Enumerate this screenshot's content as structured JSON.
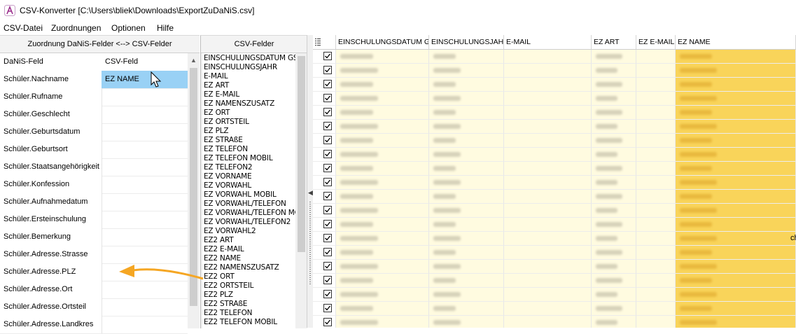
{
  "window": {
    "title": "CSV-Konverter [C:\\Users\\bliek\\Downloads\\ExportZuDaNiS.csv]",
    "app_icon": "app-logo-icon"
  },
  "menu": {
    "items": [
      "CSV-Datei",
      "Zuordnungen",
      "Optionen",
      "Hilfe"
    ]
  },
  "mapping": {
    "panel_title": "Zuordnung DaNiS-Felder <--> CSV-Felder",
    "col_dan": "DaNiS-Feld",
    "col_csv": "CSV-Feld",
    "rows": [
      {
        "dan": "Schüler.Nachname",
        "csv": "EZ NAME"
      },
      {
        "dan": "Schüler.Rufname",
        "csv": ""
      },
      {
        "dan": "Schüler.Geschlecht",
        "csv": ""
      },
      {
        "dan": "Schüler.Geburtsdatum",
        "csv": ""
      },
      {
        "dan": "Schüler.Geburtsort",
        "csv": ""
      },
      {
        "dan": "Schüler.Staatsangehörigkeit",
        "csv": ""
      },
      {
        "dan": "Schüler.Konfession",
        "csv": ""
      },
      {
        "dan": "Schüler.Aufnahmedatum",
        "csv": ""
      },
      {
        "dan": "Schüler.Ersteinschulung",
        "csv": ""
      },
      {
        "dan": "Schüler.Bemerkung",
        "csv": ""
      },
      {
        "dan": "Schüler.Adresse.Strasse",
        "csv": ""
      },
      {
        "dan": "Schüler.Adresse.PLZ",
        "csv": ""
      },
      {
        "dan": "Schüler.Adresse.Ort",
        "csv": ""
      },
      {
        "dan": "Schüler.Adresse.Ortsteil",
        "csv": ""
      },
      {
        "dan": "Schüler.Adresse.Landkres",
        "csv": ""
      }
    ]
  },
  "csv_fields": {
    "panel_title": "CSV-Felder",
    "items": [
      "EINSCHULUNGSDATUM GS",
      "EINSCHULUNGSJAHR",
      "E-MAIL",
      "EZ ART",
      "EZ E-MAIL",
      "EZ NAMENSZUSATZ",
      "EZ ORT",
      "EZ ORTSTEIL",
      "EZ PLZ",
      "EZ STRAßE",
      "EZ TELEFON",
      "EZ TELEFON MOBIL",
      "EZ TELEFON2",
      "EZ VORNAME",
      "EZ VORWAHL",
      "EZ VORWAHL MOBIL",
      "EZ VORWAHL/TELEFON",
      "EZ VORWAHL/TELEFON MC",
      "EZ VORWAHL/TELEFON2",
      "EZ VORWAHL2",
      "EZ2 ART",
      "EZ2 E-MAIL",
      "EZ2 NAME",
      "EZ2 NAMENSZUSATZ",
      "EZ2 ORT",
      "EZ2 ORTSTEIL",
      "EZ2 PLZ",
      "EZ2 STRAßE",
      "EZ2 TELEFON",
      "EZ2 TELEFON MOBIL"
    ]
  },
  "data_grid": {
    "menu_icon": "list-menu-icon",
    "columns": [
      "EINSCHULUNGSDATUM GS",
      "EINSCHULUNGSJAHR",
      "E-MAIL",
      "EZ ART",
      "EZ E-MAIL",
      "EZ NAME"
    ],
    "row_count": 20,
    "row_truncated_char": "ch"
  },
  "colors": {
    "selection": "#99d1f5",
    "highlight_yellow": "#fffbe0",
    "name_column": "#f9d45a",
    "arrow": "#f5a623"
  }
}
